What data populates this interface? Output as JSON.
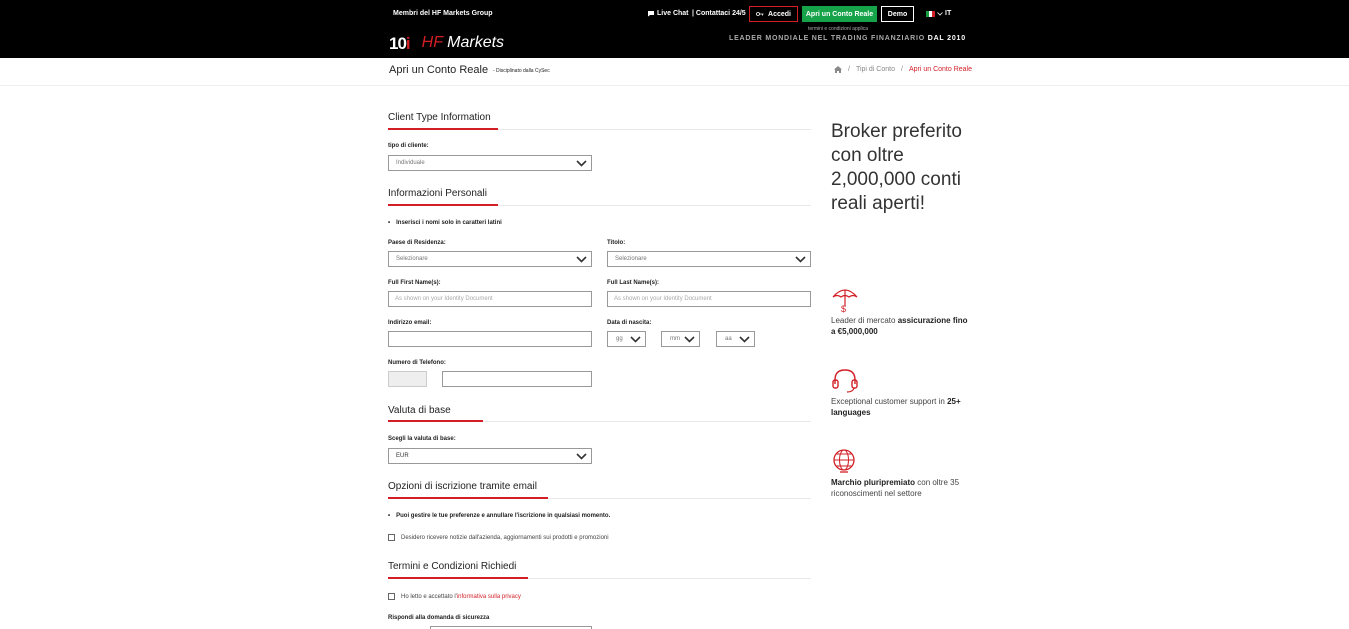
{
  "topbar": {
    "members": "Membri del HF Markets Group",
    "live_chat": "Live Chat",
    "contact": "Contattaci 24/5",
    "login": "Accedi",
    "open_real": "Apri un Conto Reale",
    "demo": "Demo",
    "lang": "IT",
    "terms": "termini e condizioni applica",
    "logo_number": "10",
    "logo_i": "i",
    "logo_hf": "HF",
    "logo_markets": " Markets",
    "tagline": "LEADER MONDIALE NEL TRADING FINANZIARIO",
    "tagline_since": "DAL 2010"
  },
  "page": {
    "title": "Apri un Conto Reale",
    "subtitle": "- Disciplinato dalla CySec",
    "breadcrumb": {
      "level1": "Tipi di Conto",
      "level2": "Apri un Conto Reale"
    }
  },
  "form": {
    "client_type": {
      "title": "Client Type Information",
      "label": "tipo di cliente:",
      "value": "Individuale"
    },
    "personal": {
      "title": "Informazioni Personali",
      "note": "Inserisci i nomi solo in caratteri latini",
      "country_label": "Paese di Residenza:",
      "country_value": "Selezionare",
      "title_label": "Titolo:",
      "title_value": "Selezionare",
      "first_name_label": "Full First Name(s):",
      "first_name_placeholder": "As shown on your Identity Document",
      "last_name_label": "Full Last Name(s):",
      "last_name_placeholder": "As shown on your Identity Document",
      "email_label": "Indirizzo email:",
      "dob_label": "Data di nascita:",
      "dob_day": "gg",
      "dob_month": "mm",
      "dob_year": "aa",
      "phone_label": "Numero di Telefono:"
    },
    "currency": {
      "title": "Valuta di base",
      "label": "Scegli la valuta di base:",
      "value": "EUR"
    },
    "email_options": {
      "title": "Opzioni di iscrizione tramite email",
      "note": "Puoi gestire le tue preferenze e annullare l'iscrizione in qualsiasi momento.",
      "checkbox": "Desidero ricevere notizie dall'azienda, aggiornamenti sui prodotti e promozioni"
    },
    "terms": {
      "title": "Termini e Condizioni Richiedi",
      "checkbox_prefix": "Ho letto e accettato l'",
      "checkbox_link": "informativa sulla privacy",
      "security_label": "Rispondi alla domanda di sicurezza"
    }
  },
  "sidebar": {
    "headline": "Broker preferito con oltre 2,000,000 conti reali aperti!",
    "features": [
      {
        "pre": "Leader di mercato ",
        "bold": "assicurazione fino a €5,000,000",
        "post": ""
      },
      {
        "pre": "Exceptional customer support in ",
        "bold": "25+ languages",
        "post": ""
      },
      {
        "pre": "",
        "bold": "Marchio pluripremiato",
        "post": " con oltre 35 riconoscimenti nel settore"
      }
    ]
  },
  "colors": {
    "brand_red": "#d21f26",
    "green": "#16a34a",
    "topbar": "#000000"
  }
}
